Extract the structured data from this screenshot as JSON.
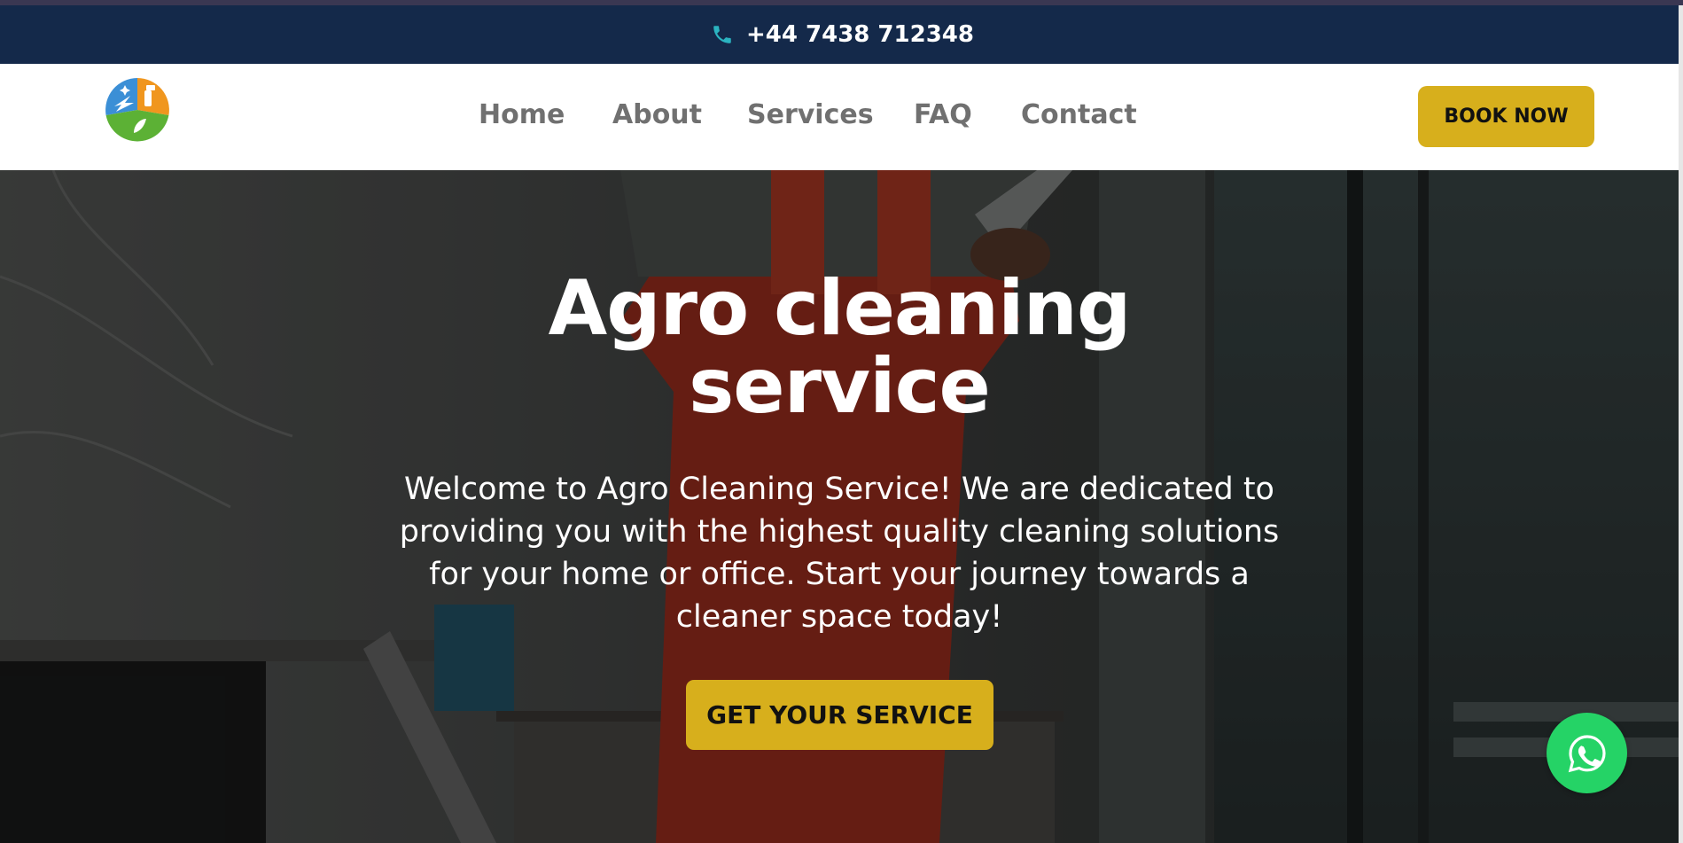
{
  "topbar": {
    "phone_icon": "phone-icon",
    "phone_number": "+44 7438 712348"
  },
  "header": {
    "logo_icon": "cleaning-logo-icon",
    "nav": [
      {
        "label": "Home"
      },
      {
        "label": "About"
      },
      {
        "label": "Services"
      },
      {
        "label": "FAQ"
      },
      {
        "label": "Contact"
      }
    ],
    "book_label": "BOOK NOW"
  },
  "hero": {
    "title": "Agro cleaning service",
    "subtitle": "Welcome to Agro Cleaning Service! We are dedicated to providing you with the highest quality cleaning solutions for your home or office. Start your journey towards a cleaner space today!",
    "cta_label": "GET YOUR SERVICE"
  },
  "floating": {
    "whatsapp_icon": "whatsapp-icon"
  },
  "colors": {
    "topbar_bg": "#14294a",
    "accent": "#d7af1c",
    "nav_text": "#707070",
    "whatsapp": "#25d366",
    "phone_icon": "#2bb3c0"
  }
}
